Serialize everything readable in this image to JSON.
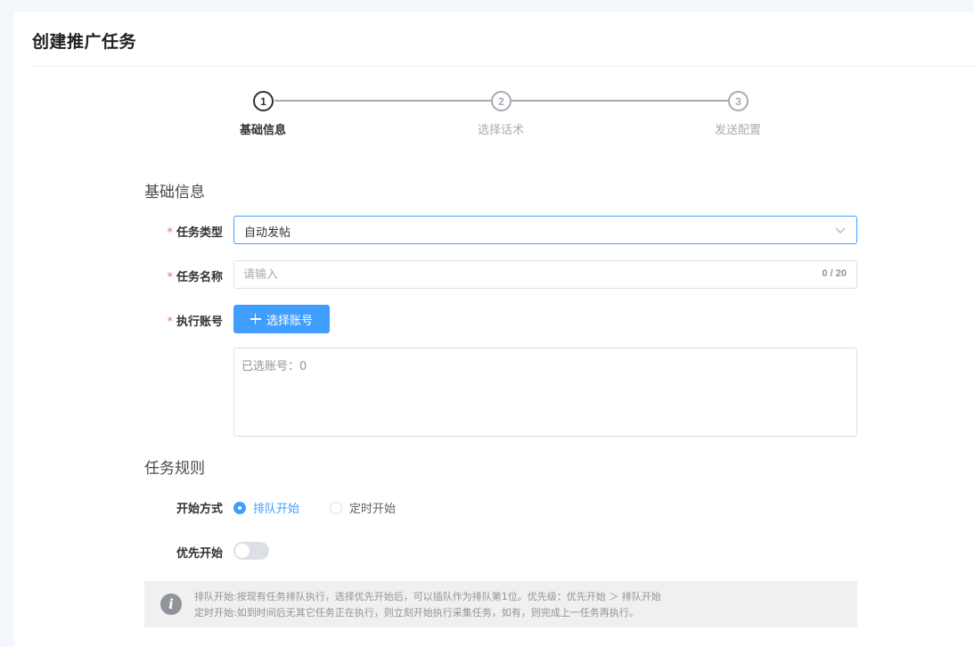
{
  "page": {
    "title": "创建推广任务"
  },
  "steps": [
    {
      "number": "1",
      "label": "基础信息",
      "active": true
    },
    {
      "number": "2",
      "label": "选择话术",
      "active": false
    },
    {
      "number": "3",
      "label": "发送配置",
      "active": false
    }
  ],
  "sections": {
    "basic": "基础信息",
    "rules": "任务规则"
  },
  "form": {
    "required_mark": "*",
    "task_type": {
      "label": "任务类型",
      "value": "自动发帖"
    },
    "task_name": {
      "label": "任务名称",
      "placeholder": "请输入",
      "value": "",
      "counter": "0 / 20"
    },
    "account": {
      "label": "执行账号",
      "button_label": "选择账号",
      "selected_text": "已选账号：0"
    },
    "start_mode": {
      "label": "开始方式",
      "options": [
        {
          "label": "排队开始",
          "checked": true
        },
        {
          "label": "定时开始",
          "checked": false
        }
      ]
    },
    "priority_start": {
      "label": "优先开始",
      "enabled": false
    }
  },
  "info": {
    "icon": "info-icon",
    "lines": [
      "排队开始:按现有任务排队执行，选择优先开始后，可以插队作为排队第1位。优先级：优先开始 ＞ 排队开始",
      "定时开始:如到时间后无其它任务正在执行，则立刻开始执行采集任务，如有，则完成上一任务再执行。"
    ]
  },
  "colors": {
    "accent": "#409eff",
    "required": "#f56c6c",
    "step_active": "#303133",
    "step_inactive": "#a8abb2"
  }
}
